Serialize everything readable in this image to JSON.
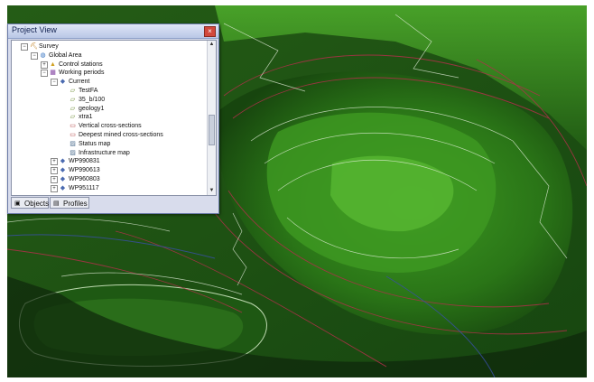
{
  "panel": {
    "title": "Project View",
    "close_label": "×",
    "tree": [
      {
        "label": "Survey",
        "icon": "survey-icon",
        "indent": 0,
        "expander": "⊟"
      },
      {
        "label": "Global Area",
        "icon": "area-icon",
        "indent": 1,
        "expander": "⊟"
      },
      {
        "label": "Control stations",
        "icon": "stations-icon",
        "indent": 2,
        "expander": "⊞"
      },
      {
        "label": "Working periods",
        "icon": "periods-icon",
        "indent": 2,
        "expander": "⊟"
      },
      {
        "label": "Current",
        "icon": "period-icon",
        "indent": 3,
        "expander": "⊟"
      },
      {
        "label": "TestFA",
        "icon": "layer-icon",
        "indent": 4,
        "expander": ""
      },
      {
        "label": "35_b/100",
        "icon": "layer-icon",
        "indent": 4,
        "expander": ""
      },
      {
        "label": "geology1",
        "icon": "layer-icon",
        "indent": 4,
        "expander": ""
      },
      {
        "label": "xtra1",
        "icon": "layer-icon",
        "indent": 4,
        "expander": ""
      },
      {
        "label": "Vertical cross-sections",
        "icon": "section-icon",
        "indent": 4,
        "expander": ""
      },
      {
        "label": "Deepest mined cross-sections",
        "icon": "section-icon",
        "indent": 4,
        "expander": ""
      },
      {
        "label": "Status map",
        "icon": "map-icon",
        "indent": 4,
        "expander": ""
      },
      {
        "label": "Infrastructure map",
        "icon": "map-icon",
        "indent": 4,
        "expander": ""
      },
      {
        "label": "WP990831",
        "icon": "period-icon",
        "indent": 3,
        "expander": "⊞"
      },
      {
        "label": "WP990613",
        "icon": "period-icon",
        "indent": 3,
        "expander": "⊞"
      },
      {
        "label": "WP960803",
        "icon": "period-icon",
        "indent": 3,
        "expander": "⊞"
      },
      {
        "label": "WP951117",
        "icon": "period-icon",
        "indent": 3,
        "expander": "⊞"
      }
    ],
    "tabs": [
      {
        "label": "Objects",
        "icon": "objects-icon"
      },
      {
        "label": "Profiles",
        "icon": "profiles-icon"
      }
    ]
  },
  "colors": {
    "terrain_dark": "#14360f",
    "terrain_mid": "#2f7a1c",
    "terrain_light": "#6bcf3c",
    "contour_red": "#b0304a",
    "contour_white": "#e8f2e0",
    "road_blue": "#3a4fa8"
  }
}
